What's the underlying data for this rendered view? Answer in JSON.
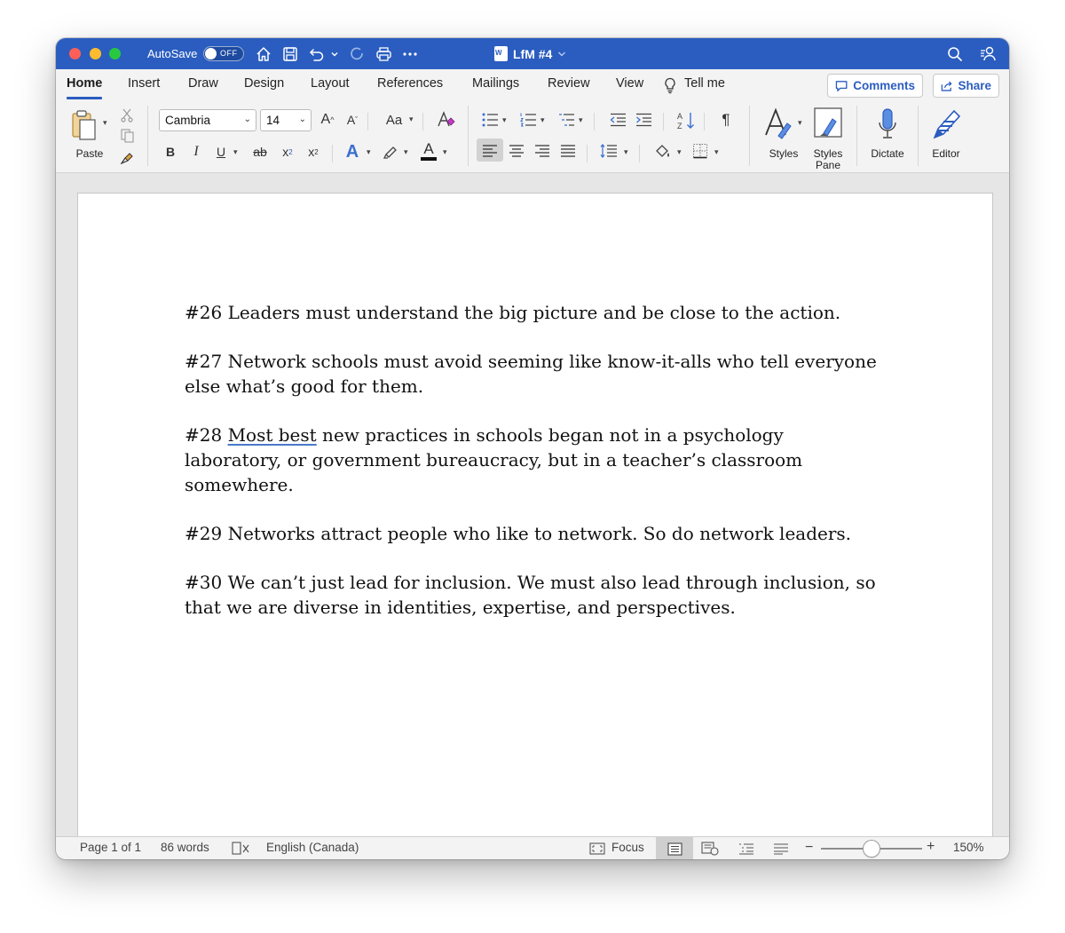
{
  "titlebar": {
    "autosave_label": "AutoSave",
    "autosave_state": "OFF",
    "document_title": "LfM #4"
  },
  "tabs": [
    {
      "label": "Home",
      "active": true
    },
    {
      "label": "Insert"
    },
    {
      "label": "Draw"
    },
    {
      "label": "Design"
    },
    {
      "label": "Layout"
    },
    {
      "label": "References"
    },
    {
      "label": "Mailings"
    },
    {
      "label": "Review"
    },
    {
      "label": "View"
    }
  ],
  "tell_me": "Tell me",
  "comments_label": "Comments",
  "share_label": "Share",
  "ribbon": {
    "paste_label": "Paste",
    "font_name": "Cambria",
    "font_size": "14",
    "grow_font": "A",
    "shrink_font": "A",
    "change_case": "Aa",
    "bold": "B",
    "italic": "I",
    "underline": "U",
    "strikethrough": "ab",
    "subscript": "x",
    "subscript_mark": "2",
    "superscript": "x",
    "superscript_mark": "2",
    "text_effects": "A",
    "font_color": "A",
    "pilcrow": "¶",
    "styles_label": "Styles",
    "styles_pane_label_1": "Styles",
    "styles_pane_label_2": "Pane",
    "dictate_label": "Dictate",
    "editor_label": "Editor"
  },
  "document": {
    "p26": "#26 Leaders must understand the big picture and be close to the action.",
    "p27": "#27 Network schools must avoid seeming like know-it-alls who tell everyone else what’s good for them.",
    "p28_prefix": "#28 ",
    "p28_flagged": "Most best",
    "p28_rest": " new practices in schools began not in a psychology laboratory, or government bureaucracy, but in a teacher’s classroom somewhere.",
    "p29": "#29 Networks attract people who like to network. So do network leaders.",
    "p30": "#30 We can’t just lead for inclusion. We must also lead through inclusion, so that we are diverse in identities, expertise, and perspectives."
  },
  "statusbar": {
    "page_info": "Page 1 of 1",
    "word_count": "86 words",
    "language": "English (Canada)",
    "focus_label": "Focus",
    "zoom_minus": "−",
    "zoom_plus": "+",
    "zoom_level": "150%",
    "zoom_fraction": 0.5
  },
  "colors": {
    "titlebar": "#2b5dc0",
    "accent": "#2b5dc0"
  }
}
